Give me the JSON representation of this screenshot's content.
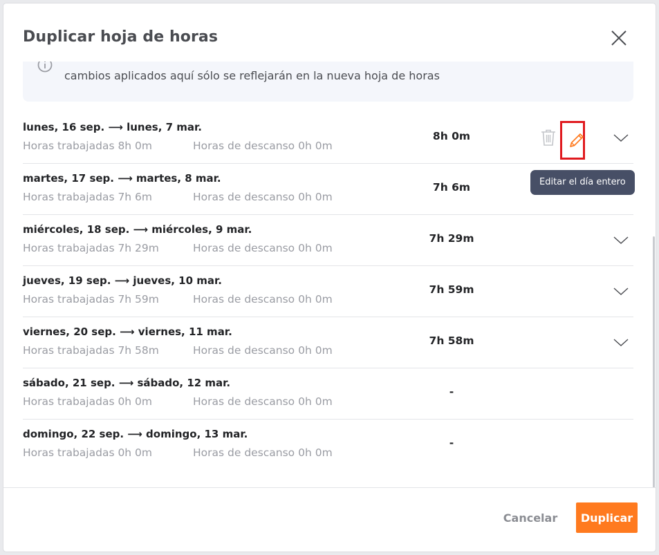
{
  "modal": {
    "title": "Duplicar hoja de horas",
    "close_icon": "close-icon"
  },
  "info": {
    "icon": "info-icon",
    "line1": "",
    "line2": "cambios aplicados aquí sólo se reflejarán en la nueva hoja de horas"
  },
  "days": [
    {
      "title": "lunes, 16 sep. ⟶ lunes, 7 mar.",
      "worked": "Horas trabajadas 8h 0m",
      "break": "Horas de descanso 0h 0m",
      "total": "8h 0m"
    },
    {
      "title": "martes, 17 sep. ⟶ martes, 8 mar.",
      "worked": "Horas trabajadas 7h 6m",
      "break": "Horas de descanso 0h 0m",
      "total": "7h 6m"
    },
    {
      "title": "miércoles, 18 sep. ⟶ miércoles, 9 mar.",
      "worked": "Horas trabajadas 7h 29m",
      "break": "Horas de descanso 0h 0m",
      "total": "7h 29m"
    },
    {
      "title": "jueves, 19 sep. ⟶ jueves, 10 mar.",
      "worked": "Horas trabajadas 7h 59m",
      "break": "Horas de descanso 0h 0m",
      "total": "7h 59m"
    },
    {
      "title": "viernes, 20 sep. ⟶ viernes, 11 mar.",
      "worked": "Horas trabajadas 7h 58m",
      "break": "Horas de descanso 0h 0m",
      "total": "7h 58m"
    },
    {
      "title": "sábado, 21 sep. ⟶ sábado, 12 mar.",
      "worked": "Horas trabajadas 0h 0m",
      "break": "Horas de descanso 0h 0m",
      "total": "-"
    },
    {
      "title": "domingo, 22 sep. ⟶ domingo, 13 mar.",
      "worked": "Horas trabajadas 0h 0m",
      "break": "Horas de descanso 0h 0m",
      "total": "-"
    }
  ],
  "tooltip": {
    "text": "Editar el día entero"
  },
  "footer": {
    "cancel_label": "Cancelar",
    "duplicate_label": "Duplicar"
  },
  "colors": {
    "accent": "#ff7a1f",
    "highlight_border": "#e0191e",
    "tooltip_bg": "#474f66",
    "muted_text": "#9a9ca3"
  }
}
